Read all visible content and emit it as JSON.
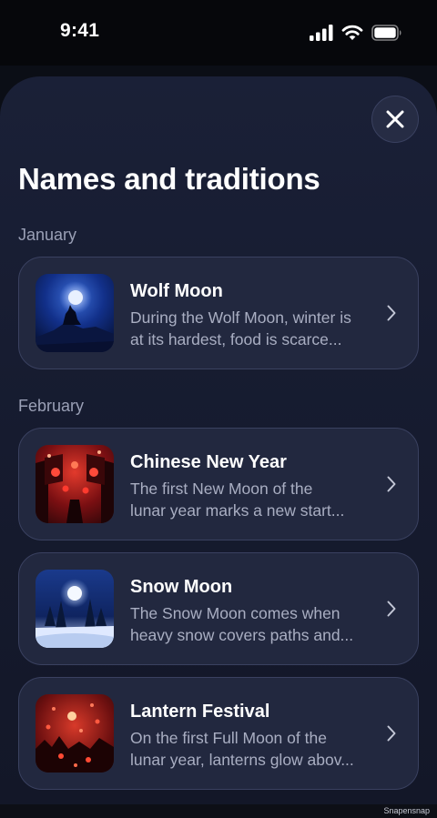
{
  "status_bar": {
    "time": "9:41"
  },
  "header": {
    "title": "Names and traditions"
  },
  "sections": [
    {
      "month": "January",
      "items": [
        {
          "title": "Wolf Moon",
          "desc_lines": [
            "During the Wolf Moon, winter is",
            "at its hardest, food is scarce..."
          ],
          "image": "wolf-howling-moon"
        }
      ]
    },
    {
      "month": "February",
      "items": [
        {
          "title": "Chinese New Year",
          "desc_lines": [
            "The first New Moon of the",
            "lunar year marks a new start..."
          ],
          "image": "red-lantern-street"
        },
        {
          "title": "Snow Moon",
          "desc_lines": [
            "The Snow Moon comes when",
            "heavy snow covers paths and..."
          ],
          "image": "snowy-forest-moon"
        },
        {
          "title": "Lantern Festival",
          "desc_lines": [
            "On the first Full Moon of the",
            "lunar year, lanterns glow abov..."
          ],
          "image": "floating-red-lanterns"
        }
      ]
    }
  ],
  "watermark": "Snapensnap",
  "icons": {
    "close": "close-icon",
    "chevron": "chevron-right-icon"
  },
  "colors": {
    "background": "#161b2f",
    "card": "#22283f",
    "card_border": "#3a4160",
    "muted_text": "#a9aec2"
  }
}
